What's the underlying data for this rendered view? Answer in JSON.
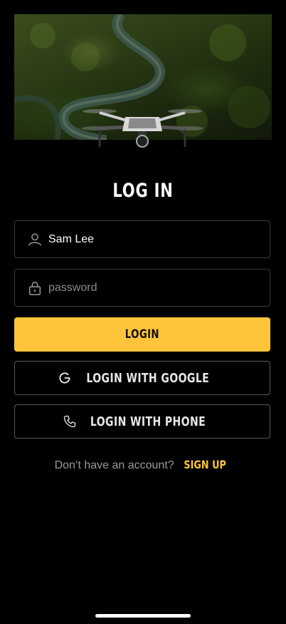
{
  "hero": {
    "image_alt": "Aerial view of forest river with drone"
  },
  "title": "LOG IN",
  "username": {
    "value": "Sam Lee",
    "icon": "user-icon"
  },
  "password": {
    "placeholder": "password",
    "value": "",
    "icon": "lock-icon"
  },
  "login_button": "LOGIN",
  "google_button": {
    "label": "LOGIN WITH GOOGLE",
    "icon": "google-icon"
  },
  "phone_button": {
    "label": "LOGIN WITH PHONE",
    "icon": "phone-icon"
  },
  "signup": {
    "prompt": "Don’t have an account?",
    "link": "SIGN UP"
  },
  "colors": {
    "accent": "#ffc43a",
    "background": "#000000",
    "border": "#3a3a3a"
  }
}
